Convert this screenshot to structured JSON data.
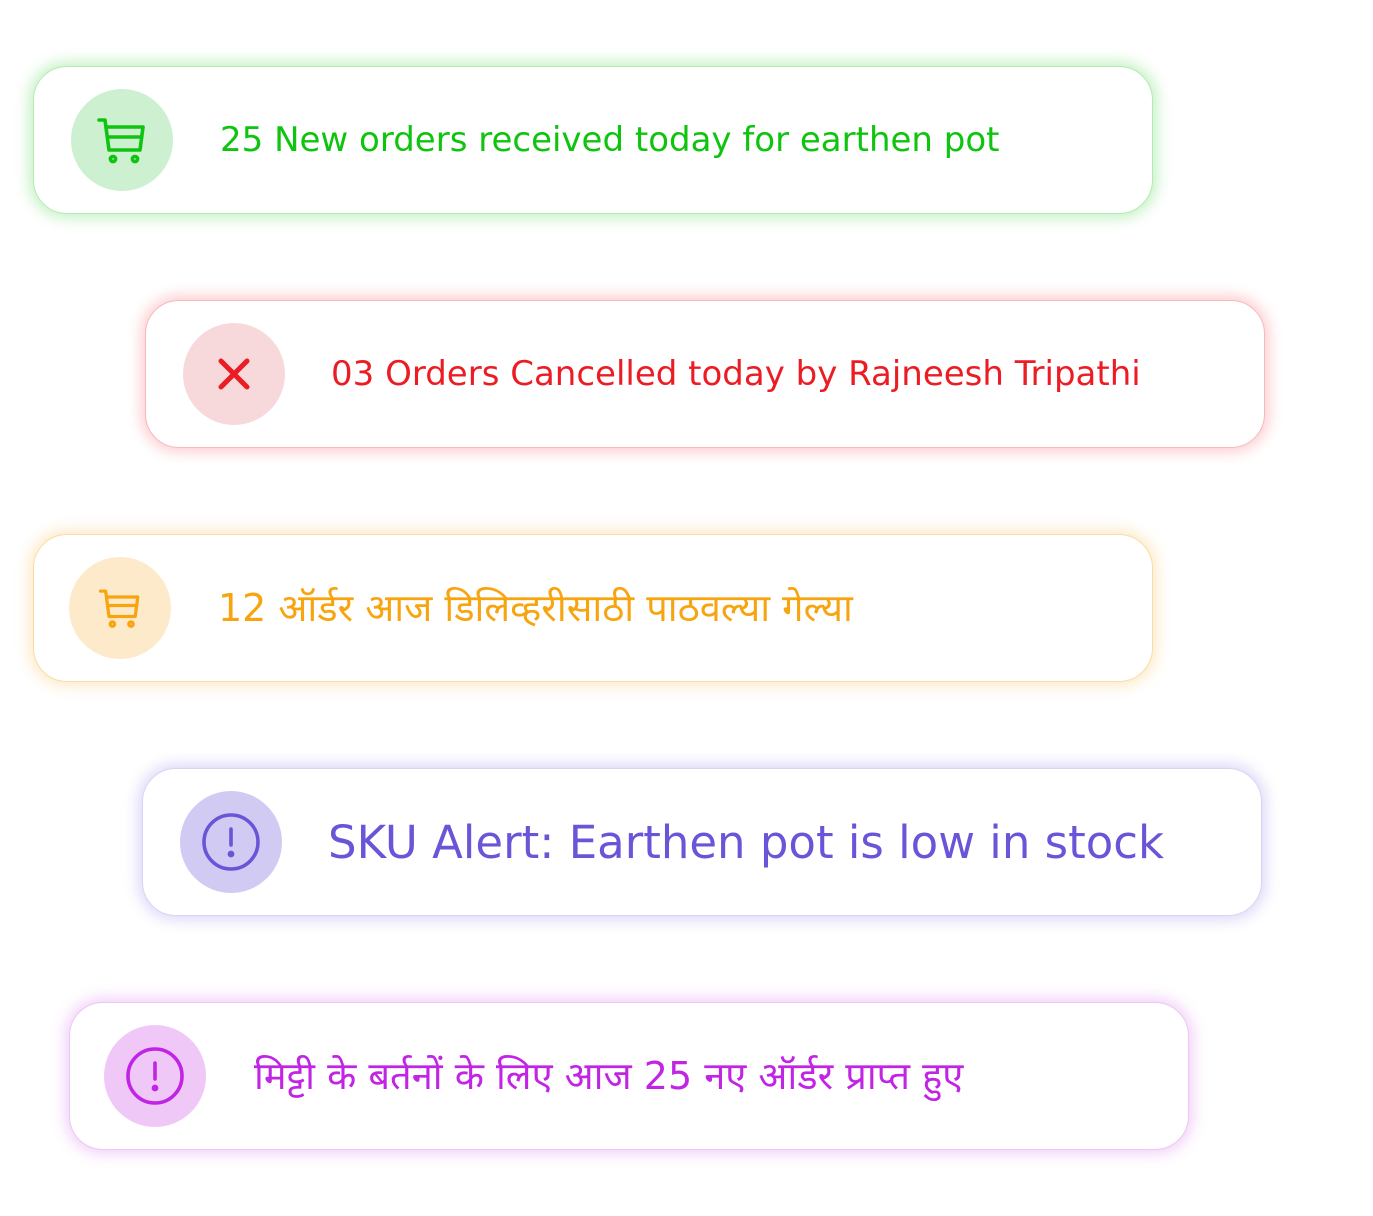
{
  "notifications": [
    {
      "id": "orders-received",
      "icon": "cart-icon",
      "color": "#0fc40f",
      "message": "25 New orders received today for earthen pot"
    },
    {
      "id": "orders-cancelled",
      "icon": "close-icon",
      "color": "#ec1c24",
      "message": "03 Orders Cancelled today by Rajneesh Tripathi"
    },
    {
      "id": "orders-dispatched",
      "icon": "cart-icon",
      "color": "#f8a40f",
      "message": "12 ऑर्डर आज डिलिव्हरीसाठी पाठवल्या गेल्या"
    },
    {
      "id": "sku-alert",
      "icon": "alert-circle-icon",
      "color": "#6a54d7",
      "message": "SKU Alert: Earthen pot is low in stock"
    },
    {
      "id": "orders-received-hindi",
      "icon": "alert-circle-icon",
      "color": "#c124e4",
      "message": "मिट्टी के बर्तनों के लिए आज 25 नए ऑर्डर प्राप्त हुए"
    }
  ]
}
